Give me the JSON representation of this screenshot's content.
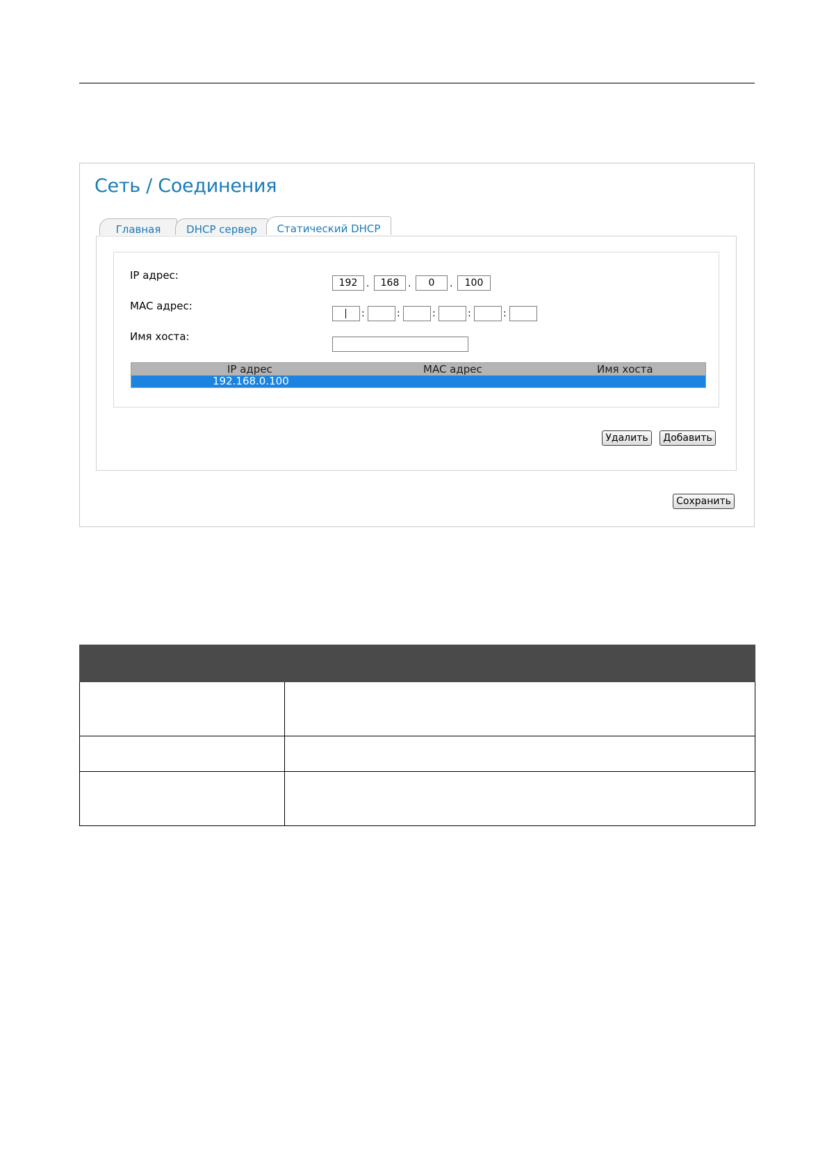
{
  "page": {
    "title": "Сеть / Соединения",
    "tabs": [
      {
        "label": "Главная",
        "active": false
      },
      {
        "label": "DHCP сервер",
        "active": false
      },
      {
        "label": "Статический DHCP",
        "active": true
      }
    ]
  },
  "form": {
    "ip_label": "IP адрес:",
    "ip_octets": [
      "192",
      "168",
      "0",
      "100"
    ],
    "ip_separator": ".",
    "mac_label": "MAC адрес:",
    "mac_parts": [
      "",
      "",
      "",
      "",
      "",
      ""
    ],
    "mac_separator": ":",
    "host_label": "Имя хоста:",
    "host_value": ""
  },
  "grid": {
    "columns": [
      "IP адрес",
      "MAC адрес",
      "Имя хоста"
    ],
    "rows": [
      {
        "ip": "192.168.0.100",
        "mac": "",
        "host": "",
        "selected": true
      }
    ]
  },
  "buttons": {
    "delete": "Удалить",
    "add": "Добавить",
    "save": "Сохранить"
  },
  "colors": {
    "title": "#1a7bb7",
    "selected_row": "#1c84e0",
    "grid_header": "#b4b4b4",
    "table_header": "#4a4a4a"
  },
  "description_table": {
    "header": [
      "",
      ""
    ],
    "rows": [
      [
        "",
        ""
      ],
      [
        "",
        ""
      ],
      [
        "",
        ""
      ]
    ]
  }
}
